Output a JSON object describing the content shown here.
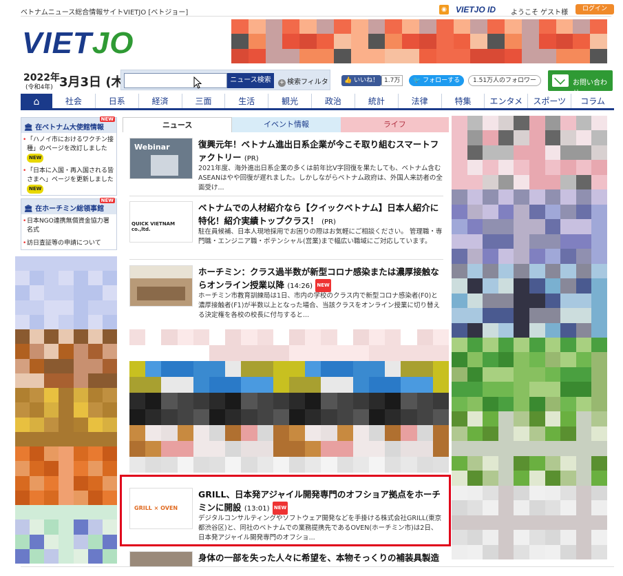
{
  "topbar": {
    "site_label": "ベトナムニュース総合情報サイトVIETJO [ベトジョー]",
    "rss": "RSS",
    "vietjo_id": "VIETJO ID",
    "welcome": "ようこそ ゲスト様",
    "login": "ログイン"
  },
  "logo": {
    "viet": "VIET",
    "jo": "JO"
  },
  "date": {
    "year": "2022年",
    "era": "(令和4年)",
    "month_day": "3月3日 (木)"
  },
  "search": {
    "placeholder": "",
    "button": "ニュース検索",
    "filter": "検索フィルタ"
  },
  "social": {
    "fb_like": "いいね！",
    "fb_count": "1.7万",
    "tw_follow": "フォローする",
    "tw_count": "1.51万人のフォロワー"
  },
  "contact": "お問い合わせ",
  "nav": [
    "社会",
    "日系",
    "経済",
    "三面",
    "生活",
    "観光",
    "政治",
    "統計",
    "法律",
    "特集",
    "エンタメ",
    "スポーツ",
    "コラム"
  ],
  "left": {
    "embassy": {
      "title": "在ベトナム大使館情報",
      "new": "NEW",
      "items": [
        "「ハノイ市におけるワクチン接種」のページを改訂しました",
        "「日本に入国・再入国される皆さまへ」ページを更新しました"
      ]
    },
    "consulate": {
      "title": "在ホーチミン総領事館",
      "new": "NEW",
      "items": [
        "日本NGO連携無償資金協力署名式",
        "訪日査証等の申請について"
      ]
    },
    "new_tag": "NEW"
  },
  "tabs": [
    "ニュース",
    "イベント情報",
    "ライフ"
  ],
  "news": [
    {
      "title": "復興元年！ベトナム進出日系企業が今こそ取り組むスマートファクトリー",
      "time": "(PR)",
      "body": "2021年度、海外進出日系企業の多くは前年比V字回復を果たしても、ベトナム含むASEANはやや回復が遅れました。しかしながらベトナム政府は、外国人来訪者の全面受け...",
      "thumb_text": "Webinar"
    },
    {
      "title": "ベトナムでの人材紹介なら【クイックベトナム】日本人紹介に特化！紹介実績トップクラス！",
      "time": "(PR)",
      "body": "駐在員候補、日本人現地採用でお困りの際はお気軽にご相談ください。 管理職・専門職・エンジニア職・ポテンシャル(営業)まで幅広い職域にご対応しています。",
      "thumb_text": "QUICK VIETNAM co.,ltd."
    },
    {
      "title": "ホーチミン：クラス過半数が新型コロナ感染または濃厚接触ならオンライン授業以降",
      "time": "(14:26)",
      "body": "ホーチミン市教育訓練局は1日、市内の学校のクラス内で新型コロナ感染者(F0)と濃厚接触者(F1)が半数以上となった場合、当該クラスをオンライン授業に切り替える決定権を各校の校長に付与すると...",
      "thumb_text": ""
    },
    {
      "title": "GRILL、日本発アジャイル開発専門のオフショア拠点をホーチミンに開設",
      "time": "(13:01)",
      "body": "デジタルコンサルティングやソフトウェア開発などを手掛ける株式会社GRILL(東京都渋谷区)と、同社のベトナムでの業務提携先であるOVEN(ホーチミン市)は2日、日本発アジャイル開発専門のオフショ...",
      "thumb_text": "GRILL × OVEN"
    },
    {
      "title": "身体の一部を失った人々に希望を、本物そっくりの補装具製造",
      "time": "",
      "body": "",
      "thumb_text": ""
    }
  ],
  "new_badge": "NEW",
  "colors": {
    "brand_blue": "#1a3a8a",
    "brand_green": "#2f9a34",
    "highlight_red": "#e0001a"
  }
}
